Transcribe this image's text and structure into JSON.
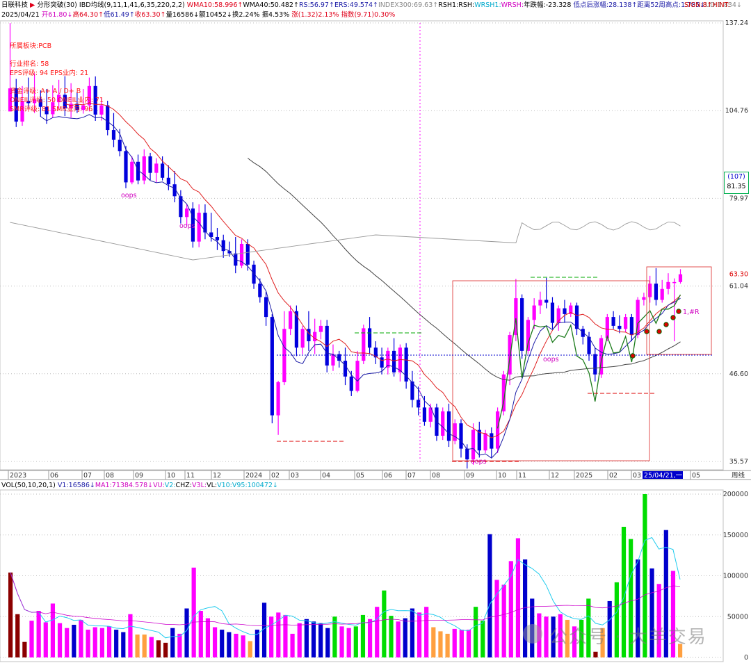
{
  "header": {
    "line1": [
      {
        "t": "日联科技",
        "c": "k"
      },
      {
        "t": " ▶ ",
        "c": "r"
      },
      {
        "t": "分形突破(30) IBD均线(9,11,1,41,6,35,220,2,2) ",
        "c": "k"
      },
      {
        "t": "WMA10:58.996↑",
        "c": "r"
      },
      {
        "t": "WMA40:50.482↑",
        "c": "k"
      },
      {
        "t": "RS:56.97↑",
        "c": "b"
      },
      {
        "t": "ERS:49.574↑",
        "c": "b"
      },
      {
        "t": "INDEX300:69.63↑",
        "c": "g"
      },
      {
        "t": "RSH1:",
        "c": "k"
      },
      {
        "t": "RSH:",
        "c": "k"
      },
      {
        "t": "WRSH1:",
        "c": "c"
      },
      {
        "t": "WRSH:",
        "c": "m"
      },
      {
        "t": "年跌幅:-23.328 ",
        "c": "k"
      },
      {
        "t": "低点后涨幅:28.138↑",
        "c": "b"
      },
      {
        "t": "距离52周高点:1.785↓",
        "c": "b"
      },
      {
        "t": "UD:1.834↓",
        "c": "g"
      }
    ],
    "line1_right": "SIGN:8↑HINT:",
    "line2": [
      {
        "t": "2025/04/21 ",
        "c": "k"
      },
      {
        "t": "开61.80↓",
        "c": "m"
      },
      {
        "t": "高64.30↑",
        "c": "r"
      },
      {
        "t": "低61.49↑",
        "c": "b"
      },
      {
        "t": "收63.30↑",
        "c": "r"
      },
      {
        "t": "量16586↓",
        "c": "k"
      },
      {
        "t": "额10452↓",
        "c": "k"
      },
      {
        "t": "换2.24% 振4.53% ",
        "c": "k"
      },
      {
        "t": "涨(1.32)2.13% ",
        "c": "r"
      },
      {
        "t": "指数(9.71)0.30%",
        "c": "r"
      }
    ]
  },
  "notes": [
    "所属板块:PCB",
    "行业排名: 58",
    "EPS评级: 94 EPS业内: 21",
    "资金评级: A+ A / D+ B",
    "ONEIL评级: 50 ONEIL业内: 71",
    "SMR评级: 81 SMR业内: 96"
  ],
  "vol_header": [
    {
      "t": "VOL(50,10,20,1) ",
      "c": "k"
    },
    {
      "t": "V1:16586↓",
      "c": "b"
    },
    {
      "t": "MA1:71384.578↓",
      "c": "m"
    },
    {
      "t": "VU:",
      "c": "m"
    },
    {
      "t": "V2:",
      "c": "c"
    },
    {
      "t": "CHZ:",
      "c": "k"
    },
    {
      "t": "V3L:",
      "c": "m"
    },
    {
      "t": "VL:",
      "c": "k"
    },
    {
      "t": "V10:",
      "c": "c"
    },
    {
      "t": "V95:100472↓",
      "c": "c"
    }
  ],
  "badge": {
    "top": "(107)",
    "bottom": "81.35"
  },
  "watermark": "公众号 · 大羊交易",
  "chart_data": {
    "type": "candlestick",
    "price_axis": {
      "ticks": [
        137.24,
        104.76,
        79.97,
        61.04,
        46.6,
        35.57
      ],
      "scale": "log",
      "last_price": "63.30"
    },
    "volume_axis": {
      "ticks": [
        200000,
        150000,
        100000,
        50000,
        0
      ],
      "labels": [
        "200000",
        "150000",
        "100000",
        "50000",
        "0"
      ]
    },
    "time_axis": [
      "2023",
      "06",
      "07",
      "08",
      "09",
      "10",
      "11",
      "12",
      "2024",
      "02",
      "03",
      "04",
      "05",
      "06",
      "07",
      "08",
      "09",
      "10",
      "11",
      "12",
      "2025",
      "02",
      "03",
      "25/04/21,一",
      "05"
    ],
    "time_axis_right": "周线",
    "annotations": [
      "oops",
      "oops",
      "oops",
      "oops",
      "1,#R"
    ],
    "candles": [
      [
        104.5,
        137.2,
        104.5,
        112.2
      ],
      [
        112.2,
        115.5,
        99.6,
        101.3
      ],
      [
        101.3,
        113.0,
        100.0,
        108.0
      ],
      [
        108.0,
        116.0,
        105.5,
        107.2
      ],
      [
        107.2,
        117.5,
        104.0,
        108.5
      ],
      [
        108.5,
        111.5,
        102.8,
        106.0
      ],
      [
        106.0,
        112.0,
        100.6,
        103.6
      ],
      [
        103.6,
        113.3,
        102.5,
        107.5
      ],
      [
        107.5,
        115.2,
        105.0,
        110.0
      ],
      [
        110.0,
        116.5,
        103.0,
        105.5
      ],
      [
        105.5,
        114.0,
        102.5,
        107.0
      ],
      [
        107.0,
        111.0,
        104.0,
        105.0
      ],
      [
        105.0,
        112.0,
        103.8,
        106.5
      ],
      [
        106.5,
        116.0,
        104.5,
        113.0
      ],
      [
        113.0,
        116.4,
        101.5,
        103.5
      ],
      [
        103.5,
        109.0,
        101.6,
        106.5
      ],
      [
        106.5,
        108.0,
        97.1,
        98.7
      ],
      [
        98.7,
        104.0,
        93.6,
        95.8
      ],
      [
        95.8,
        99.0,
        91.0,
        92.5
      ],
      [
        92.5,
        94.0,
        82.5,
        84.0
      ],
      [
        84.0,
        91.0,
        83.5,
        89.5
      ],
      [
        89.5,
        91.5,
        83.5,
        84.5
      ],
      [
        84.5,
        93.0,
        83.5,
        91.0
      ],
      [
        91.0,
        92.0,
        84.6,
        86.5
      ],
      [
        86.5,
        90.5,
        84.0,
        89.0
      ],
      [
        89.0,
        91.0,
        84.5,
        85.2
      ],
      [
        85.2,
        88.5,
        82.0,
        83.5
      ],
      [
        83.5,
        87.0,
        79.0,
        80.5
      ],
      [
        80.5,
        82.0,
        74.0,
        75.5
      ],
      [
        75.5,
        78.5,
        73.5,
        77.5
      ],
      [
        77.5,
        79.0,
        68.7,
        70.0
      ],
      [
        70.0,
        78.5,
        68.8,
        76.5
      ],
      [
        76.5,
        78.5,
        70.5,
        72.0
      ],
      [
        72.0,
        76.5,
        70.0,
        71.0
      ],
      [
        71.0,
        73.0,
        68.2,
        70.3
      ],
      [
        70.3,
        71.5,
        66.6,
        68.0
      ],
      [
        68.0,
        70.0,
        66.8,
        67.5
      ],
      [
        67.5,
        71.0,
        63.5,
        65.0
      ],
      [
        65.0,
        70.5,
        64.5,
        69.5
      ],
      [
        69.5,
        70.5,
        64.0,
        65.2
      ],
      [
        65.2,
        66.0,
        60.5,
        61.5
      ],
      [
        61.5,
        62.5,
        58.0,
        59.0
      ],
      [
        59.0,
        60.0,
        54.0,
        55.5
      ],
      [
        55.5,
        56.0,
        40.0,
        41.0
      ],
      [
        41.0,
        45.6,
        38.6,
        45.4
      ],
      [
        45.4,
        56.5,
        45.0,
        53.5
      ],
      [
        53.5,
        57.5,
        52.5,
        56.5
      ],
      [
        56.5,
        57.5,
        49.2,
        50.5
      ],
      [
        50.5,
        54.0,
        49.5,
        53.5
      ],
      [
        53.5,
        56.5,
        50.0,
        51.5
      ],
      [
        51.5,
        55.2,
        49.5,
        53.0
      ],
      [
        53.0,
        55.0,
        51.8,
        54.0
      ],
      [
        54.0,
        55.0,
        46.8,
        47.8
      ],
      [
        47.8,
        51.0,
        47.0,
        49.5
      ],
      [
        49.5,
        50.0,
        47.5,
        48.5
      ],
      [
        48.5,
        50.5,
        45.0,
        46.2
      ],
      [
        46.2,
        47.0,
        43.5,
        44.2
      ],
      [
        44.2,
        50.0,
        44.0,
        48.5
      ],
      [
        48.5,
        54.2,
        48.0,
        53.6
      ],
      [
        53.6,
        55.5,
        49.5,
        50.5
      ],
      [
        50.5,
        51.5,
        48.0,
        49.0
      ],
      [
        49.0,
        50.5,
        46.5,
        47.5
      ],
      [
        47.5,
        50.5,
        46.5,
        50.0
      ],
      [
        50.0,
        52.0,
        46.2,
        46.8
      ],
      [
        46.8,
        51.0,
        45.5,
        50.5
      ],
      [
        50.5,
        51.2,
        44.5,
        45.5
      ],
      [
        45.5,
        47.0,
        42.0,
        43.0
      ],
      [
        43.0,
        44.8,
        41.0,
        42.0
      ],
      [
        42.0,
        43.5,
        39.7,
        40.2
      ],
      [
        40.2,
        42.5,
        39.5,
        42.0
      ],
      [
        42.0,
        42.5,
        37.9,
        38.5
      ],
      [
        38.5,
        42.0,
        38.0,
        41.5
      ],
      [
        41.5,
        42.5,
        37.2,
        37.9
      ],
      [
        37.9,
        40.5,
        37.5,
        40.0
      ],
      [
        40.0,
        40.5,
        36.0,
        37.0
      ],
      [
        37.0,
        37.5,
        34.8,
        35.8
      ],
      [
        35.8,
        40.0,
        35.2,
        39.2
      ],
      [
        39.2,
        40.2,
        36.0,
        36.8
      ],
      [
        36.8,
        39.2,
        36.5,
        38.8
      ],
      [
        38.8,
        39.5,
        36.0,
        37.0
      ],
      [
        37.0,
        42.0,
        36.5,
        41.5
      ],
      [
        41.5,
        47.0,
        41.0,
        46.5
      ],
      [
        46.5,
        53.0,
        45.0,
        52.5
      ],
      [
        52.5,
        62.4,
        51.5,
        58.8
      ],
      [
        58.8,
        59.5,
        48.8,
        50.0
      ],
      [
        50.0,
        55.5,
        49.5,
        55.0
      ],
      [
        55.0,
        58.8,
        53.5,
        57.5
      ],
      [
        57.5,
        60.0,
        56.0,
        58.5
      ],
      [
        58.5,
        62.6,
        57.0,
        58.0
      ],
      [
        58.0,
        59.0,
        53.5,
        54.5
      ],
      [
        54.5,
        57.5,
        53.2,
        57.0
      ],
      [
        57.0,
        58.5,
        54.5,
        56.0
      ],
      [
        56.0,
        58.0,
        55.5,
        57.5
      ],
      [
        57.5,
        58.0,
        52.5,
        53.5
      ],
      [
        53.5,
        54.0,
        51.0,
        52.2
      ],
      [
        52.2,
        53.0,
        48.5,
        49.5
      ],
      [
        49.5,
        50.5,
        45.5,
        46.5
      ],
      [
        46.5,
        52.5,
        46.0,
        52.0
      ],
      [
        52.0,
        56.0,
        51.5,
        55.5
      ],
      [
        55.5,
        56.5,
        53.5,
        54.0
      ],
      [
        54.0,
        55.8,
        52.8,
        53.5
      ],
      [
        53.5,
        56.0,
        53.0,
        55.5
      ],
      [
        55.5,
        56.0,
        51.5,
        52.5
      ],
      [
        52.5,
        59.0,
        52.0,
        58.5
      ],
      [
        58.5,
        59.8,
        57.5,
        59.0
      ],
      [
        59.0,
        63.0,
        58.0,
        61.5
      ],
      [
        61.5,
        64.5,
        57.5,
        58.5
      ],
      [
        58.5,
        62.2,
        58.0,
        60.5
      ],
      [
        60.5,
        63.5,
        59.5,
        61.8
      ],
      [
        61.8,
        62.5,
        51.5,
        61.8
      ],
      [
        61.8,
        64.3,
        61.5,
        63.3
      ]
    ],
    "volume": [
      {
        "v": 104000,
        "c": "#8b0000"
      },
      {
        "v": 53000,
        "c": "#8b0000"
      },
      {
        "v": 19000,
        "c": "#8b0000"
      },
      {
        "v": 45000,
        "c": "#ff00ff"
      },
      {
        "v": 57000,
        "c": "#ff00ff"
      },
      {
        "v": 43000,
        "c": "#ff00ff"
      },
      {
        "v": 66000,
        "c": "#ff00ff"
      },
      {
        "v": 42000,
        "c": "#ff00ff"
      },
      {
        "v": 36000,
        "c": "#ff00ff"
      },
      {
        "v": 40000,
        "c": "#0000cc"
      },
      {
        "v": 46000,
        "c": "#ff00ff"
      },
      {
        "v": 34000,
        "c": "#ff00ff"
      },
      {
        "v": 37000,
        "c": "#ff00ff"
      },
      {
        "v": 36000,
        "c": "#ff00ff"
      },
      {
        "v": 38000,
        "c": "#ff00ff"
      },
      {
        "v": 34000,
        "c": "#0000cc"
      },
      {
        "v": 31000,
        "c": "#0000cc"
      },
      {
        "v": 53000,
        "c": "#ff00ff"
      },
      {
        "v": 28000,
        "c": "#ffa040"
      },
      {
        "v": 28000,
        "c": "#ffa040"
      },
      {
        "v": 25000,
        "c": "#ff00ff"
      },
      {
        "v": 21000,
        "c": "#8b0000"
      },
      {
        "v": 18000,
        "c": "#8b0000"
      },
      {
        "v": 36000,
        "c": "#0000cc"
      },
      {
        "v": 29000,
        "c": "#ff00ff"
      },
      {
        "v": 60000,
        "c": "#0000cc"
      },
      {
        "v": 110000,
        "c": "#ff00ff"
      },
      {
        "v": 57000,
        "c": "#ff00ff"
      },
      {
        "v": 48000,
        "c": "#ff00ff"
      },
      {
        "v": 37000,
        "c": "#ff00ff"
      },
      {
        "v": 34000,
        "c": "#0000cc"
      },
      {
        "v": 31000,
        "c": "#0000cc"
      },
      {
        "v": 29000,
        "c": "#ff00ff"
      },
      {
        "v": 27000,
        "c": "#ff00ff"
      },
      {
        "v": 20000,
        "c": "#ffa040"
      },
      {
        "v": 34000,
        "c": "#0000cc"
      },
      {
        "v": 67000,
        "c": "#0000cc"
      },
      {
        "v": 50000,
        "c": "#ff00ff"
      },
      {
        "v": 55000,
        "c": "#ff00ff"
      },
      {
        "v": 52000,
        "c": "#ff00ff"
      },
      {
        "v": 29000,
        "c": "#ff00ff"
      },
      {
        "v": 42000,
        "c": "#ff00ff"
      },
      {
        "v": 47000,
        "c": "#0000cc"
      },
      {
        "v": 44000,
        "c": "#0000cc"
      },
      {
        "v": 42000,
        "c": "#0000cc"
      },
      {
        "v": 36000,
        "c": "#0000cc"
      },
      {
        "v": 50000,
        "c": "#00dd00"
      },
      {
        "v": 38000,
        "c": "#ff00ff"
      },
      {
        "v": 36000,
        "c": "#ff00ff"
      },
      {
        "v": 38000,
        "c": "#00dd00"
      },
      {
        "v": 52000,
        "c": "#00dd00"
      },
      {
        "v": 47000,
        "c": "#ff00ff"
      },
      {
        "v": 62000,
        "c": "#ff00ff"
      },
      {
        "v": 82000,
        "c": "#00dd00"
      },
      {
        "v": 51000,
        "c": "#00dd00"
      },
      {
        "v": 44000,
        "c": "#ff00ff"
      },
      {
        "v": 48000,
        "c": "#0000cc"
      },
      {
        "v": 60000,
        "c": "#0000cc"
      },
      {
        "v": 55000,
        "c": "#ff00ff"
      },
      {
        "v": 62000,
        "c": "#ff00ff"
      },
      {
        "v": 37000,
        "c": "#ffa040"
      },
      {
        "v": 32000,
        "c": "#ffa040"
      },
      {
        "v": 29000,
        "c": "#ffa040"
      },
      {
        "v": 35000,
        "c": "#ff00ff"
      },
      {
        "v": 34000,
        "c": "#ff00ff"
      },
      {
        "v": 34000,
        "c": "#ff00ff"
      },
      {
        "v": 62000,
        "c": "#00dd00"
      },
      {
        "v": 45000,
        "c": "#00dd00"
      },
      {
        "v": 151000,
        "c": "#0000cc"
      },
      {
        "v": 95000,
        "c": "#ff00ff"
      },
      {
        "v": 89000,
        "c": "#ff00ff"
      },
      {
        "v": 118000,
        "c": "#ff00ff"
      },
      {
        "v": 146000,
        "c": "#ff00ff"
      },
      {
        "v": 120000,
        "c": "#0000cc"
      },
      {
        "v": 72000,
        "c": "#0000cc"
      },
      {
        "v": 54000,
        "c": "#ff00ff"
      },
      {
        "v": 50000,
        "c": "#ff00ff"
      },
      {
        "v": 50000,
        "c": "#0000cc"
      },
      {
        "v": 53000,
        "c": "#ff00ff"
      },
      {
        "v": 46000,
        "c": "#ffa040"
      },
      {
        "v": 38000,
        "c": "#ff00ff"
      },
      {
        "v": 46000,
        "c": "#00dd00"
      },
      {
        "v": 72000,
        "c": "#00dd00"
      },
      {
        "v": 7000,
        "c": "#8b0000"
      },
      {
        "v": 36000,
        "c": "#ffa040"
      },
      {
        "v": 69000,
        "c": "#0000cc"
      },
      {
        "v": 92000,
        "c": "#00dd00"
      },
      {
        "v": 160000,
        "c": "#00dd00"
      },
      {
        "v": 145000,
        "c": "#00dd00"
      },
      {
        "v": 120000,
        "c": "#0000cc"
      },
      {
        "v": 200000,
        "c": "#00dd00"
      },
      {
        "v": 109000,
        "c": "#0000cc"
      },
      {
        "v": 90000,
        "c": "#ff00ff"
      },
      {
        "v": 156000,
        "c": "#0000cc"
      },
      {
        "v": 106000,
        "c": "#ff00ff"
      },
      {
        "v": 16586,
        "c": "#ffa040"
      }
    ]
  }
}
